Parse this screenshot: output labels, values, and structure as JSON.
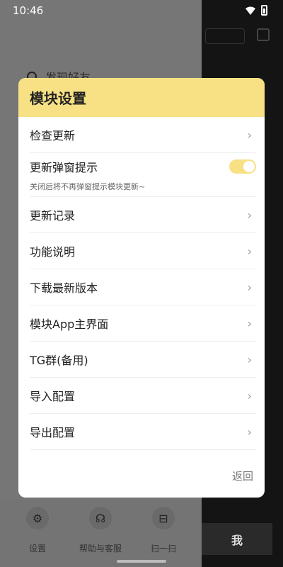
{
  "status_bar": {
    "time": "10:46"
  },
  "background": {
    "search_text": "发现好友",
    "nav": [
      {
        "label": "设置",
        "icon": "gear-icon"
      },
      {
        "label": "帮助与客服",
        "icon": "headset-icon"
      },
      {
        "label": "扫一扫",
        "icon": "scan-icon"
      }
    ],
    "me_tab": "我"
  },
  "modal": {
    "title": "模块设置",
    "items": [
      {
        "label": "检查更新"
      },
      {
        "label": "更新弹窗提示",
        "sub": "关闭后将不再弹窗提示模块更新~",
        "toggle_on": true
      },
      {
        "label": "更新记录"
      },
      {
        "label": "功能说明"
      },
      {
        "label": "下载最新版本"
      },
      {
        "label": "模块App主界面"
      },
      {
        "label": "TG群(备用)"
      },
      {
        "label": "导入配置"
      },
      {
        "label": "导出配置"
      }
    ],
    "back_label": "返回"
  },
  "colors": {
    "accent": "#f7e184"
  }
}
